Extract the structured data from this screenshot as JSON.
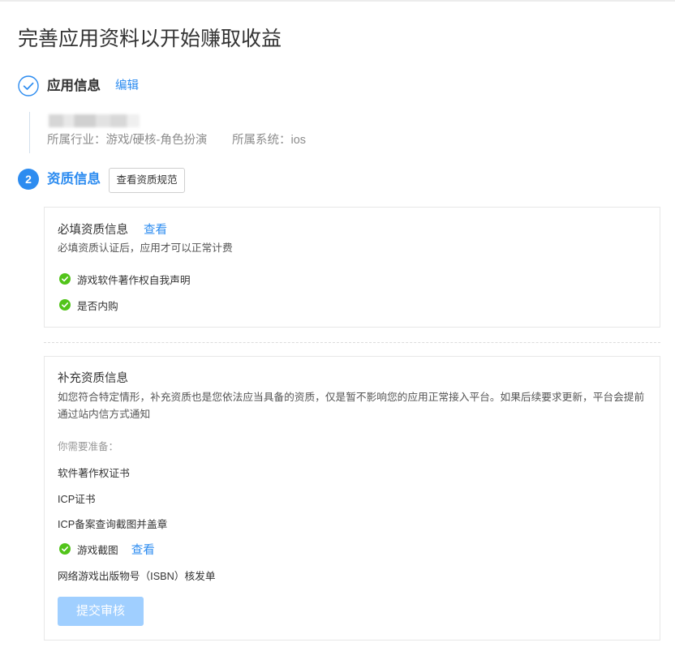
{
  "colors": {
    "primary": "#2d8cf0",
    "success": "#52c41a",
    "submit_disabled": "#a0cfff"
  },
  "icons": {
    "app_info_status": "check-circle-outline-icon",
    "completed_item": "check-circle-icon"
  },
  "page": {
    "title": "完善应用资料以开始赚取收益"
  },
  "steps": {
    "app_info": {
      "title": "应用信息",
      "edit_label": "编辑",
      "industry": "所属行业：游戏/硬核-角色扮演",
      "system": "所属系统：ios"
    },
    "qualification": {
      "number": "2",
      "title": "资质信息",
      "view_spec_label": "查看资质规范",
      "required": {
        "title": "必填资质信息",
        "view_label": "查看",
        "description": "必填资质认证后，应用才可以正常计费",
        "items": [
          {
            "label": "游戏软件著作权自我声明",
            "completed": true
          },
          {
            "label": "是否内购",
            "completed": true
          }
        ]
      },
      "supplementary": {
        "title": "补充资质信息",
        "description": "如您符合特定情形，补充资质也是您依法应当具备的资质，仅是暂不影响您的应用正常接入平台。如果后续要求更新，平台会提前通过站内信方式通知",
        "prepare_label": "你需要准备：",
        "items": [
          {
            "label": "软件著作权证书",
            "completed": false
          },
          {
            "label": "ICP证书",
            "completed": false
          },
          {
            "label": "ICP备案查询截图并盖章",
            "completed": false
          },
          {
            "label": "游戏截图",
            "completed": true,
            "view_label": "查看"
          },
          {
            "label": "网络游戏出版物号（ISBN）核发单",
            "completed": false
          }
        ],
        "submit_label": "提交审核",
        "submit_disabled": true
      }
    }
  }
}
